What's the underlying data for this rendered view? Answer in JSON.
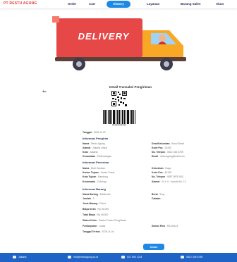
{
  "brand": "PT RESTU AGUNG",
  "nav": {
    "order": "Order",
    "cart": "Cart",
    "history": "History",
    "layanan": "Layanan",
    "barang": "Barang Sales",
    "akun": "Akun"
  },
  "hero": {
    "text": "DELIVERY"
  },
  "receipt": {
    "title": "Detail Transaksi Pengiriman",
    "barcode_text": "|||||||||||||||||||||||||||||||",
    "tanggal": {
      "label": "Tanggal",
      "value": ": 2025-11-02"
    }
  },
  "pengirim": {
    "title": "Informasi Pengirim",
    "nama": {
      "label": "Nama",
      "value": ": Restu Agung"
    },
    "alamat": {
      "label": "Alamat",
      "value": ": Jakarta Utara"
    },
    "kota": {
      "label": "Kota",
      "value": ": Jakarta"
    },
    "kecamatan": {
      "label": "Kecamatan",
      "value": ": Pademangan"
    },
    "desa": {
      "label": "Desa/Kelurahan",
      "value": ": Ancol Barat"
    },
    "kode_pos": {
      "label": "Kode Pos",
      "value": ": 14430"
    },
    "telp": {
      "label": "No. Telepon",
      "value": ": 0812 345 6789"
    },
    "email": {
      "label": "Email",
      "value": ": restu.agung@mail.com"
    }
  },
  "penerima": {
    "title": "Informasi Penerima",
    "nama": {
      "label": "Nama",
      "value": ": Budi Santoso"
    },
    "tujuan": {
      "label": "Kantor Tujuan",
      "value": ": Kantor Pusat"
    },
    "kota_tujuan": {
      "label": "Kota Tujuan",
      "value": ": Bandung"
    },
    "kecamatan": {
      "label": "Kecamatan",
      "value": ": Coblong"
    },
    "desa": {
      "label": "Kelurahan",
      "value": ": Dago"
    },
    "kode_pos": {
      "label": "Kode Pos",
      "value": ": 40135"
    },
    "telp": {
      "label": "No. Telepon",
      "value": ": 0857 9876 543"
    },
    "alamat": {
      "label": "Alamat",
      "value": ": Jl. Ir. H. Juanda No. 12"
    }
  },
  "barang": {
    "title": "Informasi Barang",
    "nama": {
      "label": "Nama Barang",
      "value": ": Elektronik"
    },
    "jumlah": {
      "label": "Jumlah",
      "value": ": 3"
    },
    "berat": {
      "label": "Berat",
      "value": ": 5 kg"
    },
    "jenis": {
      "label": "Jenis Barang",
      "value": ": Paket"
    },
    "catatan": {
      "label": "Catatan",
      "value": ": -"
    },
    "biaya": {
      "label": "Biaya Kirim",
      "value": ": Rp 45.000"
    },
    "total": {
      "label": "Total Biaya",
      "value": ": Rp 45.000"
    },
    "status": {
      "label": "Status Kirim",
      "value": ": Dalam Proses Pengiriman"
    },
    "pembayaran": {
      "label": "Pembayaran",
      "value": ": Lunas"
    },
    "resi": {
      "label": "Nomor Resi",
      "value": ": RA-00123"
    },
    "tanggal_terima": {
      "label": "Tanggal Terima",
      "value": ": 2025-11-04"
    }
  },
  "close_label": "Close",
  "footer": {
    "address": "Jakarta",
    "email": "info@restuagung.co.id",
    "phone": "021 555 1234",
    "whatsapp": "0812 345 6789"
  }
}
